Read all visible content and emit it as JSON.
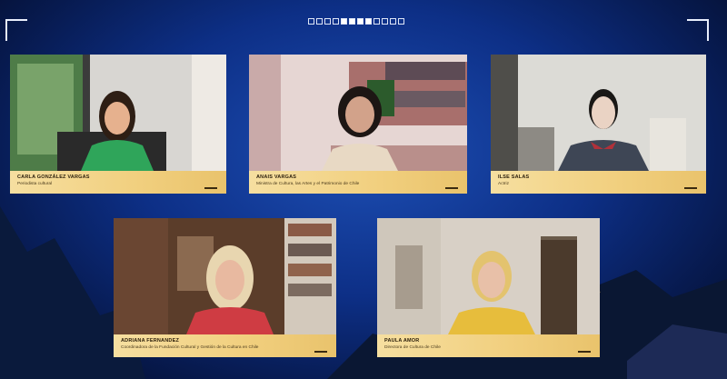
{
  "participants": [
    {
      "name": "CARLA GONZÁLEZ VARGAS",
      "role": "Periodista cultural"
    },
    {
      "name": "ANAIS VARGAS",
      "role": "Ministra de Cultura, las Artes y el Patrimonio de Chile"
    },
    {
      "name": "ILSE SALAS",
      "role": "Actriz"
    },
    {
      "name": "ADRIANA FERNANDEZ",
      "role": "Coordinadora de la Fundación Cultural y Gestión de la Cultura en Chile"
    },
    {
      "name": "PAULA AMOR",
      "role": "Directora de Cultura de Chile"
    }
  ],
  "slide_indicator": {
    "total": 12,
    "active": [
      5,
      6,
      7,
      8
    ]
  },
  "colors": {
    "background": "#0d2f86",
    "nameplate": "#f1cf7e",
    "corner": "#e8eefc"
  }
}
